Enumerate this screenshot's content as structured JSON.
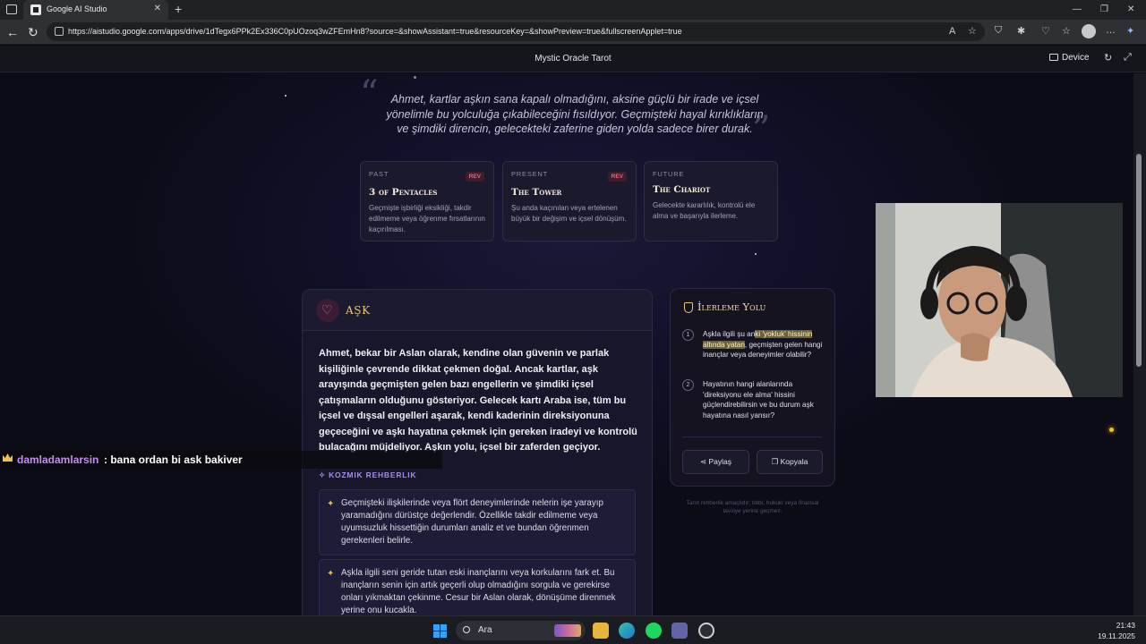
{
  "browser": {
    "tab_title": "Google AI Studio",
    "url": "https://aistudio.google.com/apps/drive/1dTegx6PPk2Ex336C0pUOzoq3wZFEmHn8?source=&showAssistant=true&resourceKey=&showPreview=true&fullscreenApplet=true",
    "new_tab": "+",
    "close_tab": "✕"
  },
  "app": {
    "title": "Mystic Oracle Tarot",
    "device_label": "Device"
  },
  "reading": {
    "quote": "Ahmet, kartlar aşkın sana kapalı olmadığını, aksine güçlü bir irade ve içsel yönelimle bu yolculuğa çıkabileceğini fısıldıyor. Geçmişteki hayal kırıklıkların ve şimdiki direncin, gelecekteki zaferine giden yolda sadece birer durak.",
    "cards": [
      {
        "position": "PAST",
        "name": "3 of Pentacles",
        "reversed_label": "REV",
        "desc": "Geçmişte işbirliği eksikliği, takdir edilmeme veya öğrenme fırsatlarının kaçırılması."
      },
      {
        "position": "PRESENT",
        "name": "The Tower",
        "reversed_label": "REV",
        "desc": "Şu anda kaçınılan veya ertelenen büyük bir değişim ve içsel dönüşüm."
      },
      {
        "position": "FUTURE",
        "name": "The Chariot",
        "reversed_label": "",
        "desc": "Gelecekte kararlılık, kontrolü ele alma ve başarıyla ilerleme."
      }
    ]
  },
  "love": {
    "title": "AŞK",
    "body": "Ahmet, bekar bir Aslan olarak, kendine olan güvenin ve parlak kişiliğinle çevrende dikkat çekmen doğal. Ancak kartlar, aşk arayışında geçmişten gelen bazı engellerin ve şimdiki içsel çatışmaların olduğunu gösteriyor. Gelecek kartı Araba ise, tüm bu içsel ve dışsal engelleri aşarak, kendi kaderinin direksiyonuna geçeceğini ve aşkı hayatına çekmek için gereken iradeyi ve kontrolü bulacağını müjdeliyor. Aşkın yolu, içsel bir zaferden geçiyor.",
    "guidance_title": "KOZMIK REHBERLIK",
    "tips": [
      "Geçmişteki ilişkilerinde veya flört deneyimlerinde nelerin işe yarayıp yaramadığını dürüstçe değerlendir. Özellikle takdir edilmeme veya uyumsuzluk hissettiğin durumları analiz et ve bundan öğrenmen gerekenleri belirle.",
      "Aşkla ilgili seni geride tutan eski inançlarını veya korkularını fark et. Bu inançların senin için artık geçerli olup olmadığını sorgula ve gerekirse onları yıkmaktan çekinme. Cesur bir Aslan olarak, dönüşüme direnmek yerine onu kucakla."
    ]
  },
  "progress": {
    "title": "İlerleme Yolu",
    "steps": [
      {
        "num": "1",
        "pre": "Aşkla ilgili şu an",
        "highlight": "ki 'yokluk' hissinin altında yatan",
        "post": ", geçmişten gelen hangi inançlar veya deneyimler olabilir?"
      },
      {
        "num": "2",
        "pre": "Hayatının hangi alanlarında 'direksiyonu ele alma' hissini güçlendirebilirsin ve bu durum aşk hayatına nasıl yansır?",
        "highlight": "",
        "post": ""
      }
    ],
    "share_label": "Paylaş",
    "copy_label": "Kopyala",
    "disclaimer": "Tarot rehberlik amaçlıdır; tıbbi, hukuki veya finansal tavsiye yerine geçmez."
  },
  "chat": {
    "username": "damladamlarsin",
    "message": ": bana ordan bi ask bakiver"
  },
  "taskbar": {
    "search_placeholder": "Ara",
    "time": "21:43",
    "date": "19.11.2025"
  },
  "icons": [
    "tabs-icon",
    "back-icon",
    "reload-icon",
    "lock-icon",
    "star-icon",
    "heart-icon",
    "sparkle-icon",
    "shield-icon",
    "share-icon",
    "copy-icon",
    "crown-icon",
    "windows-icon",
    "search-icon"
  ],
  "colors": {
    "accent_gold": "#e8c67a",
    "love_pink": "#ea6f8d",
    "guidance_purple": "#a48ef0",
    "chat_username": "#c38ef2"
  }
}
